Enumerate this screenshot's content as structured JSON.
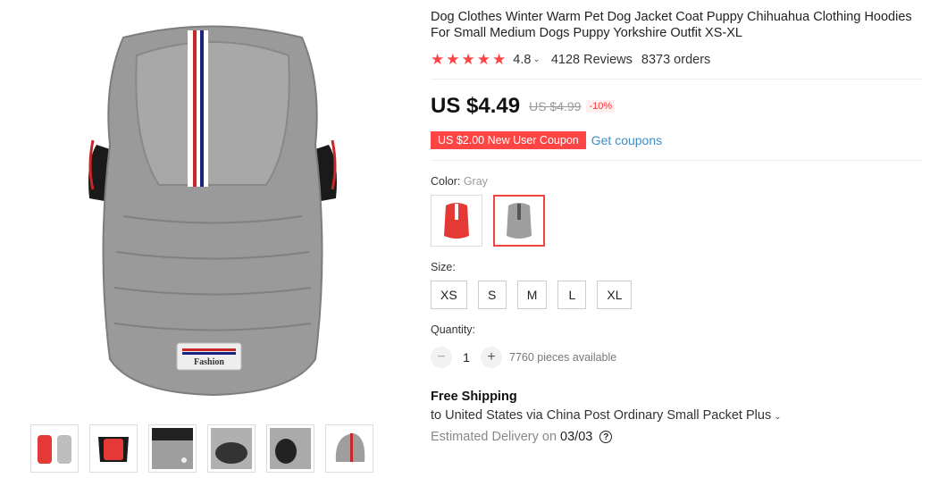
{
  "product": {
    "title": "Dog Clothes Winter Warm Pet Dog Jacket Coat Puppy Chihuahua Clothing Hoodies For Small Medium Dogs Puppy Yorkshire Outfit XS-XL",
    "rating": "4.8",
    "reviews": "4128 Reviews",
    "orders": "8373 orders"
  },
  "gallery": {
    "main_image_icon": "gray-dog-jacket-image",
    "badge_text": "Fashion",
    "thumbnails": [
      "red-gray-jackets",
      "red-black-jacket",
      "collar-detail",
      "hood-detail",
      "sleeve-detail",
      "hood-stripe-detail"
    ]
  },
  "price": {
    "current": "US $4.49",
    "original": "US $4.99",
    "discount": "-10%"
  },
  "coupon": {
    "label": "US $2.00 New User Coupon",
    "link": "Get coupons"
  },
  "color": {
    "label": "Color:",
    "selected": "Gray",
    "options": [
      {
        "name": "red",
        "color": "#e53935"
      },
      {
        "name": "gray",
        "color": "#9e9e9e"
      }
    ]
  },
  "size": {
    "label": "Size:",
    "options": [
      "XS",
      "S",
      "M",
      "L",
      "XL"
    ]
  },
  "quantity": {
    "label": "Quantity:",
    "value": "1",
    "minus": "−",
    "plus": "+",
    "available": "7760 pieces available"
  },
  "shipping": {
    "title": "Free Shipping",
    "method": "to United States via China Post Ordinary Small Packet Plus",
    "delivery_label": "Estimated Delivery on",
    "delivery_date": "03/03",
    "help": "?"
  },
  "colors": {
    "star": "#ff4747",
    "accent": "#3a8cc9",
    "coupon_bg": "#ff4747"
  }
}
